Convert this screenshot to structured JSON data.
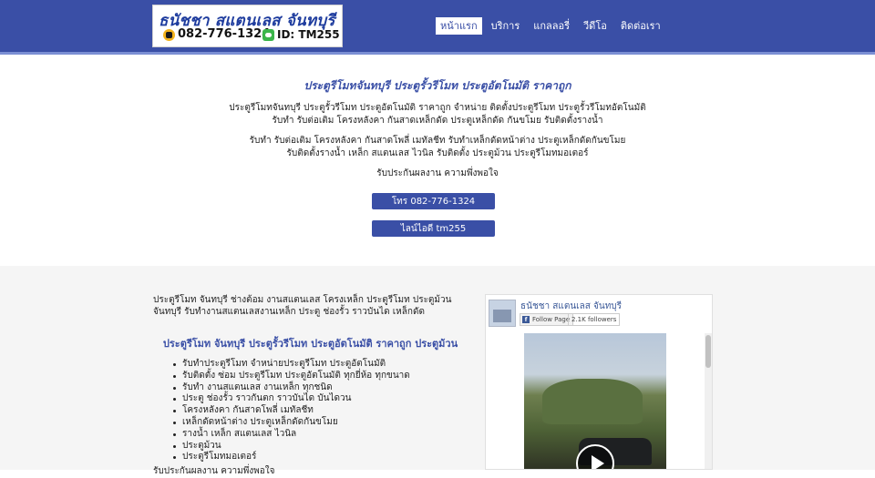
{
  "header": {
    "logo": {
      "title": "ธนัชชา สแตนเลส จันทบุรี",
      "phone": "082-776-1324",
      "line_id": "ID: TM255"
    },
    "nav": [
      {
        "label": "หน้าแรก",
        "active": true
      },
      {
        "label": "บริการ",
        "active": false
      },
      {
        "label": "แกลลอรี่",
        "active": false
      },
      {
        "label": "วีดีโอ",
        "active": false
      },
      {
        "label": "ติดต่อเรา",
        "active": false
      }
    ]
  },
  "hero": {
    "title": "ประตูรีโมทจันทบุรี ประตูรั้วรีโมท ประตูอัตโนมัติ ราคาถูก",
    "lines": [
      "ประตูรีโมทจันทบุรี ประตูรั้วรีโมท ประตูอัตโนมัติ ราคาถูก จำหน่าย ติดตั้งประตูรีโมท ประตูรั้วรีโมทอัตโนมัติ",
      "รับทำ รับต่อเติม โครงหลังคา กันสาดเหล็กดัด ประตูเหล็กดัด กันขโมย รับติดตั้งรางน้ำ",
      "รับทำ รับต่อเติม โครงหลังคา กันสาดโพลี่ เมทัลชีท รับทำเหล็กดัดหน้าต่าง ประตูเหล็กดัดกันขโมย",
      "รับติดตั้งรางน้ำ เหล็ก สแตนเลส ไวนิล รับติดตั้ง ประตูม้วน ประตูรีโมทมอเตอร์",
      "รับประกันผลงาน ความพึ่งพอใจ"
    ],
    "buttons": {
      "call": "โทร 082-776-1324",
      "line": "ไลน์ไอดี tm255"
    }
  },
  "content": {
    "intro": "ประตูรีโมท จันทบุรี ช่างต้อม งานสแตนเลส โครงเหล็ก ประตูรีโมท ประตูม้วน จันทบุรี รับทำงานสแตนเลสงานเหล็ก ประตู ช่องรั้ว ราวบันได เหล็กดัด",
    "subtitle": "ประตูรีโมท จันทบุรี ประตูรั้วรีโมท ประตูอัตโนมัติ ราคาถูก ประตูม้วน",
    "services": [
      "รับทำประตูรีโมท จำหน่ายประตูรีโมท ประตูอัตโนมัติ",
      "รับติดตั้ง ซ่อม ประตูรีโมท ประตูอัตโนมัติ ทุกยี่ห้อ ทุกขนาด",
      "รับทำ งานสแตนเลส งานเหล็ก ทุกชนิด",
      "ประตู ช่องรั้ว ราวกันตก ราวบันได บันไดวน",
      "โครงหลังคา กันสาดโพลี่ เมทัลชีท",
      "เหล็กดัดหน้าต่าง ประตูเหล็กดัดกันขโมย",
      "รางน้ำ เหล็ก สแตนเลส ไวนิล",
      "ประตูม้วน",
      "ประตูรีโมทมอเตอร์"
    ],
    "footer_text": "รับประกันผลงาน ความพึ่งพอใจ"
  },
  "facebook": {
    "page_name": "ธนัชชา สแตนเลส จันทบุรี",
    "follow_label": "Follow Page",
    "followers": "2.1K followers"
  }
}
